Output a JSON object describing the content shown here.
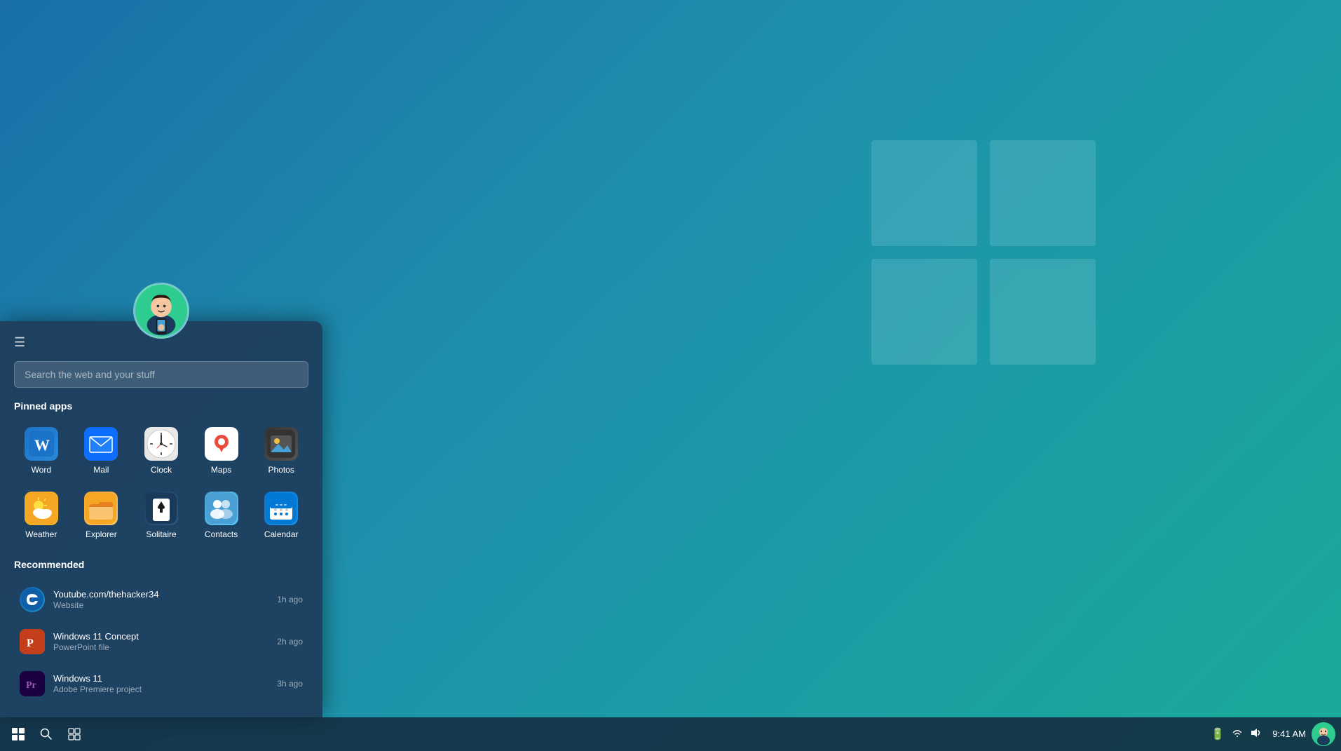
{
  "desktop": {
    "background": "teal-blue gradient"
  },
  "taskbar": {
    "start_label": "⊞",
    "search_label": "🔍",
    "widgets_label": "▦",
    "time": "9:41 AM",
    "icons": [
      "🔋",
      "📶",
      "🔊"
    ]
  },
  "start_menu": {
    "hamburger": "☰",
    "search_placeholder": "Search the web and your stuff",
    "pinned_title": "Pinned apps",
    "recommended_title": "Recommended",
    "pinned_apps": [
      {
        "id": "word",
        "label": "Word",
        "icon_type": "word"
      },
      {
        "id": "mail",
        "label": "Mail",
        "icon_type": "mail"
      },
      {
        "id": "clock",
        "label": "Clock",
        "icon_type": "clock"
      },
      {
        "id": "maps",
        "label": "Maps",
        "icon_type": "maps"
      },
      {
        "id": "photos",
        "label": "Photos",
        "icon_type": "photos"
      },
      {
        "id": "weather",
        "label": "Weather",
        "icon_type": "weather"
      },
      {
        "id": "explorer",
        "label": "Explorer",
        "icon_type": "explorer"
      },
      {
        "id": "solitaire",
        "label": "Solitaire",
        "icon_type": "solitaire"
      },
      {
        "id": "contacts",
        "label": "Contacts",
        "icon_type": "contacts"
      },
      {
        "id": "calendar",
        "label": "Calendar",
        "icon_type": "calendar"
      }
    ],
    "recommended_items": [
      {
        "id": "youtube",
        "title": "Youtube.com/thehacker34",
        "subtitle": "Website",
        "time": "1h ago",
        "icon_type": "edge"
      },
      {
        "id": "win11concept",
        "title": "Windows 11 Concept",
        "subtitle": "PowerPoint file",
        "time": "2h ago",
        "icon_type": "ppt"
      },
      {
        "id": "win11",
        "title": "Windows 11",
        "subtitle": "Adobe Premiere project",
        "time": "3h ago",
        "icon_type": "premiere"
      }
    ]
  },
  "user": {
    "avatar_emoji": "🧑‍💻"
  }
}
